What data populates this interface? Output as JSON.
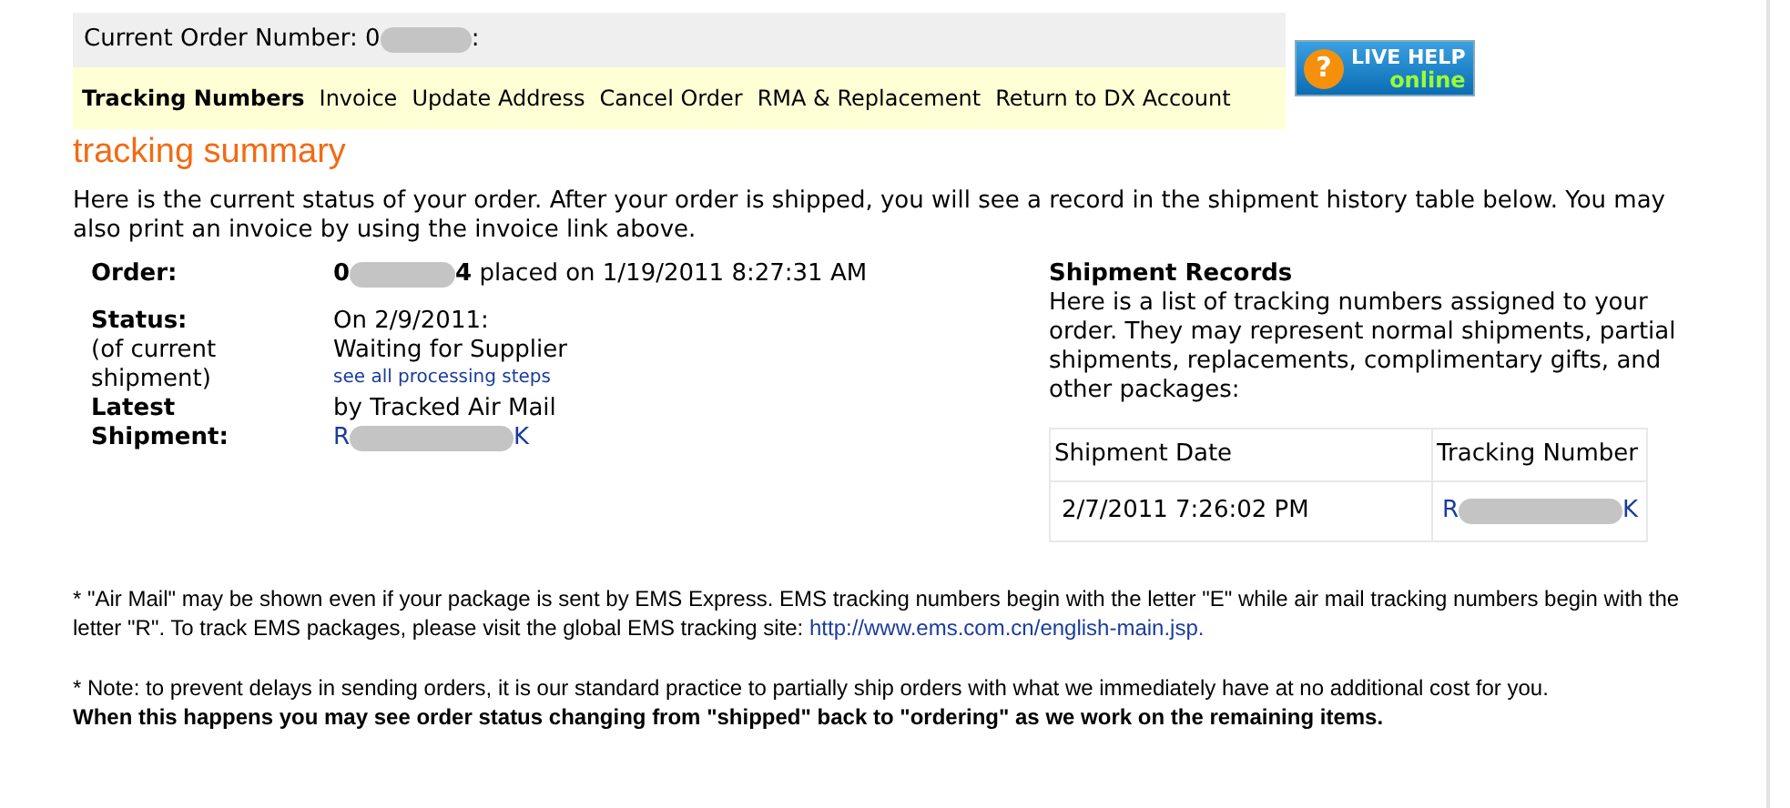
{
  "header": {
    "label": "Current Order Number: 0",
    "suffix": ":"
  },
  "nav": [
    {
      "label": "Tracking Numbers",
      "selected": true
    },
    {
      "label": "Invoice",
      "selected": false
    },
    {
      "label": "Update Address",
      "selected": false
    },
    {
      "label": "Cancel Order",
      "selected": false
    },
    {
      "label": "RMA & Replacement",
      "selected": false
    },
    {
      "label": "Return to DX Account",
      "selected": false
    }
  ],
  "live_help": {
    "line_1": "LIVE HELP",
    "line_2": "online",
    "icon": "?"
  },
  "title": "tracking summary",
  "intro": "Here is the current status of your order. After your order is shipped, you will see a record in the shipment history table below. You may also print an invoice by using the invoice link above.",
  "order": {
    "label": "Order:",
    "number_start": "0",
    "number_end": "4",
    "placed": " placed on 1/19/2011 8:27:31 AM"
  },
  "status": {
    "label": "Status:",
    "sublabel": "(of current shipment)",
    "date": "On 2/9/2011:",
    "value": "Waiting for Supplier",
    "link": "see all processing steps"
  },
  "latest": {
    "label": "Latest Shipment:",
    "method": "by Tracked Air Mail",
    "tracking_start": "R",
    "tracking_end": "K"
  },
  "records": {
    "title": "Shipment Records",
    "text": "Here is a list of tracking numbers assigned to your order. They may represent normal shipments, partial shipments, replacements, complimentary gifts, and other packages:",
    "columns": [
      "Shipment Date",
      "Tracking Number"
    ],
    "rows": [
      {
        "date": "2/7/2011 7:26:02 PM",
        "tracking_start": "R",
        "tracking_end": "K"
      }
    ]
  },
  "footnote_1": {
    "text": "* \"Air Mail\" may be shown even if your package is sent by EMS Express. EMS tracking numbers begin with the letter \"E\" while air mail tracking numbers begin with the letter \"R\". To track EMS packages, please visit the global EMS tracking site: ",
    "link": "http://www.ems.com.cn/english-main.jsp."
  },
  "footnote_2": {
    "text": "* Note: to prevent delays in sending orders, it is our standard practice to partially ship orders with what we immediately have at no additional cost for you.",
    "bold": "When this happens you may see order status changing from \"shipped\" back to \"ordering\" as we work on the remaining items."
  }
}
